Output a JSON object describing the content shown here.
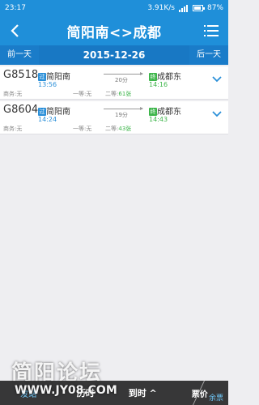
{
  "status_bar": {
    "time": "23:17",
    "speed": "3.91K/s",
    "battery": "87%"
  },
  "header": {
    "title": "简阳南<>成都"
  },
  "date_bar": {
    "prev_label": "前一天",
    "date": "2015-12-26",
    "next_label": "后一天"
  },
  "trains": [
    {
      "number": "G8518",
      "from_badge": "过",
      "from": "简阳南",
      "dep_time": "13:56",
      "duration": "20分",
      "to_badge": "终",
      "to": "成都东",
      "arr_time": "14:16",
      "seat1": "商务:无",
      "seat2": "一等:无",
      "seat3_label": "二等:",
      "seat3_count": "61张"
    },
    {
      "number": "G8604",
      "from_badge": "过",
      "from": "简阳南",
      "dep_time": "14:24",
      "duration": "19分",
      "to_badge": "终",
      "to": "成都东",
      "arr_time": "14:43",
      "seat1": "商务:无",
      "seat2": "一等:无",
      "seat3_label": "二等:",
      "seat3_count": "43张"
    }
  ],
  "bottom_bar": {
    "tab1": "发站",
    "tab2": "历时",
    "tab3": "到时 ^",
    "tab4": "票价",
    "tab4_sub": "余票"
  },
  "watermark": {
    "text": "简阳论坛",
    "url": "WWW.JY08.COM"
  },
  "colors": {
    "primary": "#1f8fd9",
    "green": "#3db54a"
  }
}
